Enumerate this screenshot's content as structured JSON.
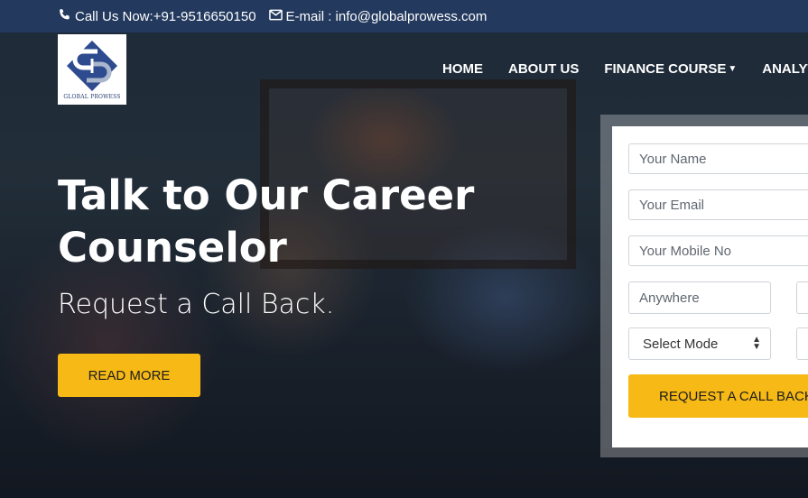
{
  "topbar": {
    "phone_text": "Call Us Now:+91-9516650150",
    "email_text": "E-mail : info@globalprowess.com"
  },
  "brand": {
    "logo_text": "GLOBAL PROWESS",
    "accent_color": "#f6b915",
    "topbar_color": "#23395e"
  },
  "nav": {
    "items": [
      {
        "label": "HOME"
      },
      {
        "label": "ABOUT US"
      },
      {
        "label": "FINANCE COURSE"
      },
      {
        "label": "ANALYTICS"
      }
    ]
  },
  "hero": {
    "headline_line1": "Talk to Our Career",
    "headline_line2": "Counselor",
    "subheadline": "Request a Call Back.",
    "read_more_label": "READ MORE"
  },
  "form": {
    "name_placeholder": "Your Name",
    "email_placeholder": "Your Email",
    "mobile_placeholder": "Your Mobile No",
    "location_placeholder": "Anywhere",
    "mode_select_value": "Select Mode",
    "submit_label": "REQUEST A CALL BACK"
  }
}
